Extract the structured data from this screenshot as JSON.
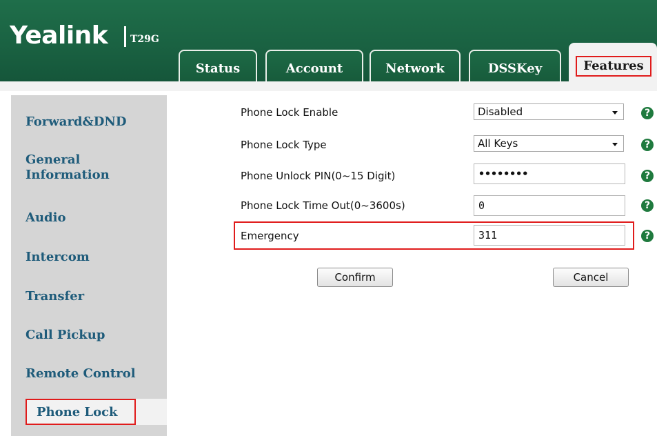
{
  "header": {
    "logo": "Yealink",
    "model": "T29G"
  },
  "tabs": [
    {
      "label": "Status"
    },
    {
      "label": "Account"
    },
    {
      "label": "Network"
    },
    {
      "label": "DSSKey"
    },
    {
      "label": "Features",
      "active": true
    }
  ],
  "sidebar": {
    "items": [
      {
        "label": "Forward&DND"
      },
      {
        "label": "General Information"
      },
      {
        "label": "Audio"
      },
      {
        "label": "Intercom"
      },
      {
        "label": "Transfer"
      },
      {
        "label": "Call Pickup"
      },
      {
        "label": "Remote Control"
      },
      {
        "label": "Phone Lock",
        "active": true
      }
    ]
  },
  "form": {
    "lock_enable": {
      "label": "Phone Lock Enable",
      "value": "Disabled"
    },
    "lock_type": {
      "label": "Phone Lock Type",
      "value": "All Keys"
    },
    "unlock_pin": {
      "label": "Phone Unlock PIN(0~15 Digit)",
      "value": "••••••••"
    },
    "lock_timeout": {
      "label": "Phone Lock Time Out(0~3600s)",
      "value": "0"
    },
    "emergency": {
      "label": "Emergency",
      "value": "311"
    },
    "help_glyph": "?",
    "confirm_label": "Confirm",
    "cancel_label": "Cancel"
  },
  "colors": {
    "header_green": "#1a6242",
    "link_blue": "#1e5b7a",
    "highlight_red": "#e01b1b",
    "help_green": "#1f7a3e"
  }
}
